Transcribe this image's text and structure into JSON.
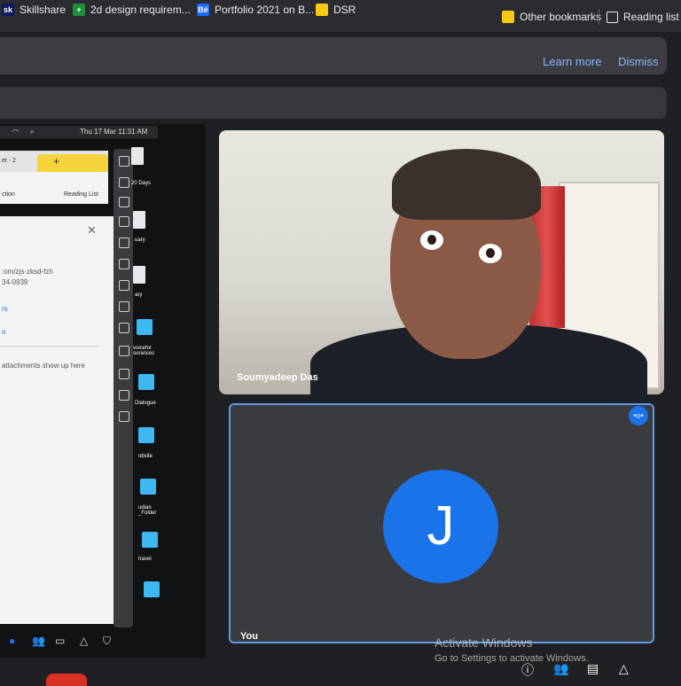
{
  "bookmarks": [
    {
      "label": "Skillshare",
      "icon": "skillshare-icon",
      "color": "#0b1b5e"
    },
    {
      "label": "2d design requirem...",
      "icon": "sheets-icon",
      "color": "#1e8e3e"
    },
    {
      "label": "Portfolio 2021 on B...",
      "icon": "behance-icon",
      "color": "#1769ff"
    },
    {
      "label": "DSR",
      "icon": "folder-icon",
      "color": "#f6c915"
    }
  ],
  "other_bookmarks": "Other bookmarks",
  "reading_list": "Reading list",
  "infobar": {
    "learn_more": "Learn more",
    "dismiss": "Dismiss"
  },
  "shared_screen": {
    "clock": "Thu 17 Mar 11:31 AM",
    "tab_title": "et - 2",
    "toolbar_left": "ction",
    "reading_list": "Reading List",
    "doc_lines": [
      ":om/zjs-zksd-fzh",
      "34-0939",
      "rs",
      "o",
      "attachments show up here"
    ],
    "desktop_labels": [
      "20 Days",
      "uary",
      "ary",
      "voicefor\nsurancec",
      "Dialogue",
      "obsite",
      "udian\n_Folder",
      "travel"
    ]
  },
  "participants": {
    "remote": {
      "name": "Soumyadeep Das"
    },
    "self": {
      "initial": "J",
      "label": "You",
      "avatar_color": "#1a73e8"
    }
  },
  "watermark": {
    "title": "Activate Windows",
    "subtitle": "Go to Settings to activate Windows."
  }
}
